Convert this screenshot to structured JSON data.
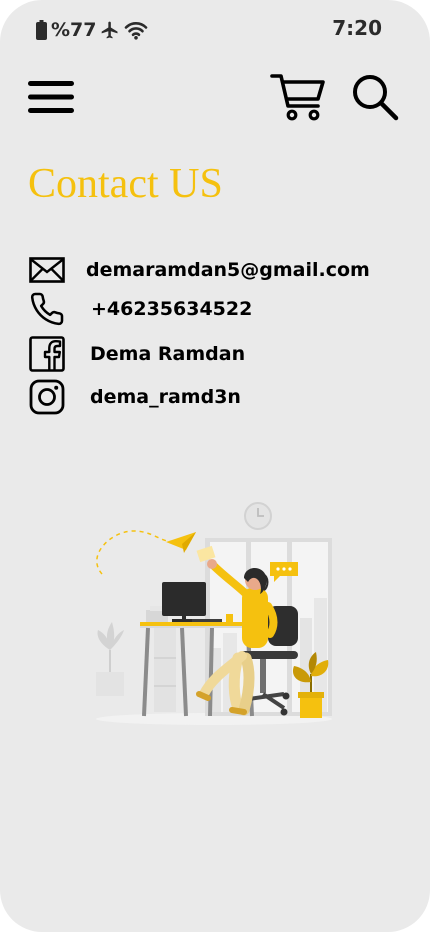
{
  "status_bar": {
    "battery_text": "%77",
    "time": "7:20",
    "icons": [
      "battery-icon",
      "airplane-icon",
      "wifi-icon"
    ]
  },
  "header": {
    "icons": [
      "hamburger-menu-icon",
      "shopping-cart-icon",
      "search-icon"
    ]
  },
  "page": {
    "title": "Contact US",
    "title_color": "#f5c10f"
  },
  "contacts": [
    {
      "icon": "mail-icon",
      "label": "demaramdan5@gmail.com"
    },
    {
      "icon": "phone-icon",
      "label": "+46235634522"
    },
    {
      "icon": "facebook-icon",
      "label": "Dema Ramdan"
    },
    {
      "icon": "instagram-icon",
      "label": "dema_ramd3n"
    }
  ],
  "illustration": {
    "name": "woman-at-desk-illustration",
    "accent": "#f5c10f"
  },
  "colors": {
    "background": "#eaeaea",
    "text": "#000000",
    "accent": "#f5c10f"
  }
}
